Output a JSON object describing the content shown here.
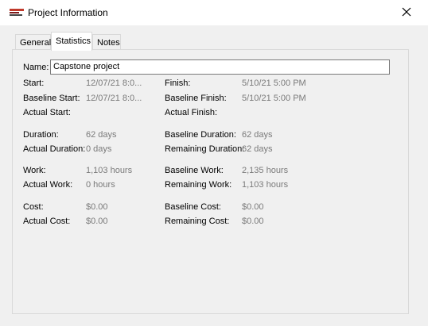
{
  "window": {
    "title": "Project Information"
  },
  "tabs": [
    {
      "label": "General"
    },
    {
      "label": "Statistics"
    },
    {
      "label": "Notes"
    }
  ],
  "name": {
    "label": "Name:",
    "value": "Capstone project"
  },
  "fields": {
    "start": {
      "label": "Start:",
      "value": "12/07/21 8:0..."
    },
    "finish": {
      "label": "Finish:",
      "value": "5/10/21 5:00 PM"
    },
    "baseline_start": {
      "label": "Baseline Start:",
      "value": "12/07/21 8:0..."
    },
    "baseline_finish": {
      "label": "Baseline Finish:",
      "value": "5/10/21 5:00 PM"
    },
    "actual_start": {
      "label": "Actual Start:",
      "value": ""
    },
    "actual_finish": {
      "label": "Actual Finish:",
      "value": ""
    },
    "duration": {
      "label": "Duration:",
      "value": "62 days"
    },
    "baseline_duration": {
      "label": "Baseline Duration:",
      "value": "62 days"
    },
    "actual_duration": {
      "label": "Actual Duration:",
      "value": "0 days"
    },
    "remaining_duration": {
      "label": "Remaining Duration:",
      "value": "62 days"
    },
    "work": {
      "label": "Work:",
      "value": "1,103 hours"
    },
    "baseline_work": {
      "label": "Baseline Work:",
      "value": "2,135 hours"
    },
    "actual_work": {
      "label": "Actual Work:",
      "value": "0 hours"
    },
    "remaining_work": {
      "label": "Remaining Work:",
      "value": "1,103 hours"
    },
    "cost": {
      "label": "Cost:",
      "value": "$0.00"
    },
    "baseline_cost": {
      "label": "Baseline Cost:",
      "value": "$0.00"
    },
    "actual_cost": {
      "label": "Actual Cost:",
      "value": "$0.00"
    },
    "remaining_cost": {
      "label": "Remaining Cost:",
      "value": "$0.00"
    }
  },
  "icons": {
    "app": "project-app-icon",
    "close": "close-icon"
  }
}
